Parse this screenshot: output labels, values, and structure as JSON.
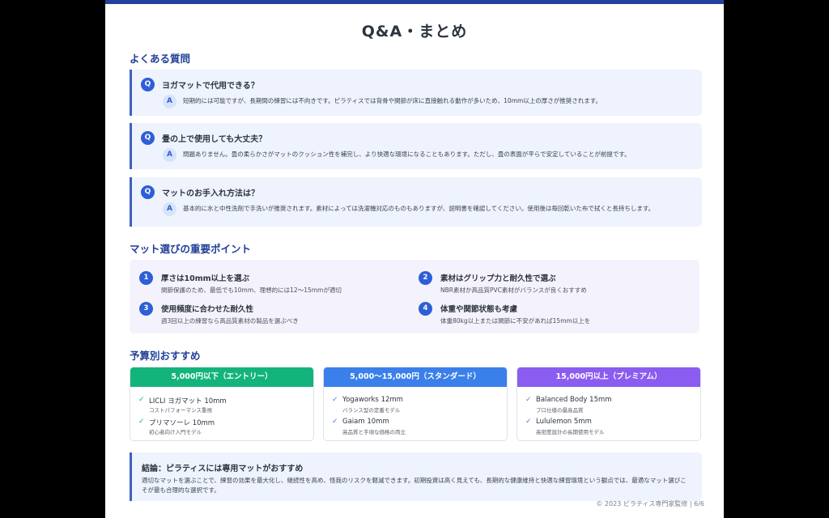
{
  "title": "Q&A・まとめ",
  "faq": {
    "heading": "よくある質問",
    "q_badge": "Q",
    "a_badge": "A",
    "items": [
      {
        "q": "ヨガマットで代用できる？",
        "a": "短期的には可能ですが、長期間の練習には不向きです。ピラティスでは背骨や関節が床に直接触れる動作が多いため、10mm以上の厚さが推奨されます。"
      },
      {
        "q": "畳の上で使用しても大丈夫？",
        "a": "問題ありません。畳の柔らかさがマットのクッション性を補完し、より快適な環境になることもあります。ただし、畳の表面が平らで安定していることが前提です。"
      },
      {
        "q": "マットのお手入れ方法は？",
        "a": "基本的に水と中性洗剤で手洗いが推奨されます。素材によっては洗濯機対応のものもありますが、説明書を確認してください。使用後は毎回乾いた布で拭くと長持ちします。"
      }
    ]
  },
  "points": {
    "heading": "マット選びの重要ポイント",
    "items": [
      {
        "num": "1",
        "title": "厚さは10mm以上を選ぶ",
        "desc": "関節保護のため、最低でも10mm、理想的には12〜15mmが適切"
      },
      {
        "num": "2",
        "title": "素材はグリップ力と耐久性で選ぶ",
        "desc": "NBR素材か高品質PVC素材がバランスが良くおすすめ"
      },
      {
        "num": "3",
        "title": "使用頻度に合わせた耐久性",
        "desc": "週3回以上の練習なら高品質素材の製品を選ぶべき"
      },
      {
        "num": "4",
        "title": "体重や関節状態も考慮",
        "desc": "体重80kg以上または関節に不安があれば15mm以上を"
      }
    ]
  },
  "budget": {
    "heading": "予算別おすすめ",
    "check_icon": "✓",
    "tiers": [
      {
        "label": "5,000円以下（エントリー）",
        "color": "#13b47b",
        "items": [
          {
            "name": "LICLI ヨガマット 10mm",
            "desc": "コストパフォーマンス重視"
          },
          {
            "name": "プリマソーレ 10mm",
            "desc": "初心者向け入門モデル"
          }
        ]
      },
      {
        "label": "5,000〜15,000円（スタンダード）",
        "color": "#3b7fea",
        "items": [
          {
            "name": "Yogaworks 12mm",
            "desc": "バランス型の定番モデル"
          },
          {
            "name": "Gaiam 10mm",
            "desc": "高品質と手頃な価格の両立"
          }
        ]
      },
      {
        "label": "15,000円以上（プレミアム）",
        "color": "#8b5cf0",
        "items": [
          {
            "name": "Balanced Body 15mm",
            "desc": "プロ仕様の最高品質"
          },
          {
            "name": "Lululemon 5mm",
            "desc": "高密度設計の長期使用モデル"
          }
        ]
      }
    ]
  },
  "conclusion": {
    "title": "結論：ピラティスには専用マットがおすすめ",
    "body": "適切なマットを選ぶことで、練習の効果を最大化し、継続性を高め、怪我のリスクを軽減できます。初期投資は高く見えても、長期的な健康維持と快適な練習環境という観点では、最適なマット選びこそが最も合理的な選択です。"
  },
  "footer": "© 2023 ピラティス専門家監修 | 6/6",
  "colors": {
    "accent": "#23409a",
    "badge": "#2d5fd6"
  }
}
